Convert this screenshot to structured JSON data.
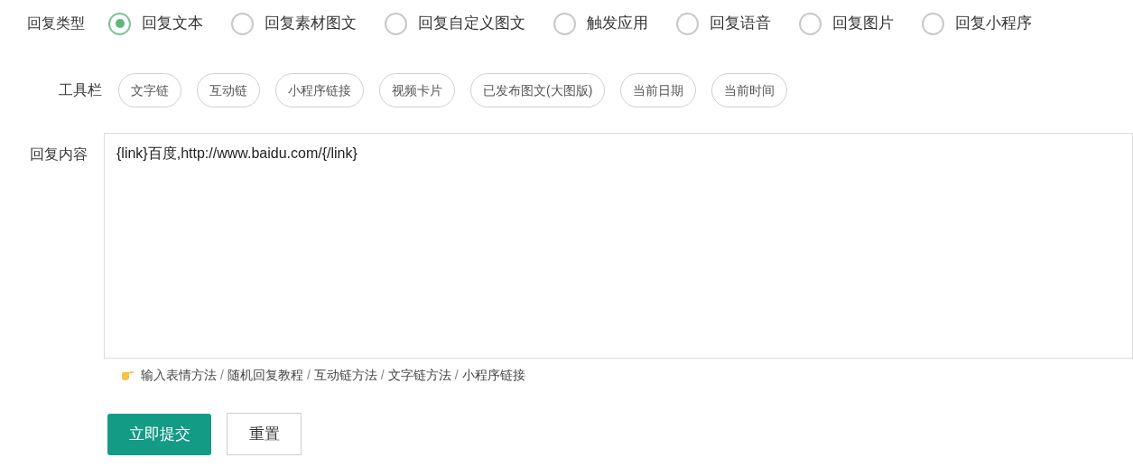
{
  "reply_type": {
    "label": "回复类型",
    "options": [
      {
        "label": "回复文本",
        "selected": true
      },
      {
        "label": "回复素材图文",
        "selected": false
      },
      {
        "label": "回复自定义图文",
        "selected": false
      },
      {
        "label": "触发应用",
        "selected": false
      },
      {
        "label": "回复语音",
        "selected": false
      },
      {
        "label": "回复图片",
        "selected": false
      },
      {
        "label": "回复小程序",
        "selected": false
      }
    ]
  },
  "toolbar": {
    "label": "工具栏",
    "buttons": [
      "文字链",
      "互动链",
      "小程序链接",
      "视频卡片",
      "已发布图文(大图版)",
      "当前日期",
      "当前时间"
    ]
  },
  "reply_content": {
    "label": "回复内容",
    "value": "{link}百度,http://www.baidu.com/{/link}"
  },
  "help_links": {
    "separator": "/",
    "links": [
      "输入表情方法",
      "随机回复教程",
      "互动链方法",
      "文字链方法",
      "小程序链接"
    ]
  },
  "buttons": {
    "submit": "立即提交",
    "reset": "重置"
  }
}
